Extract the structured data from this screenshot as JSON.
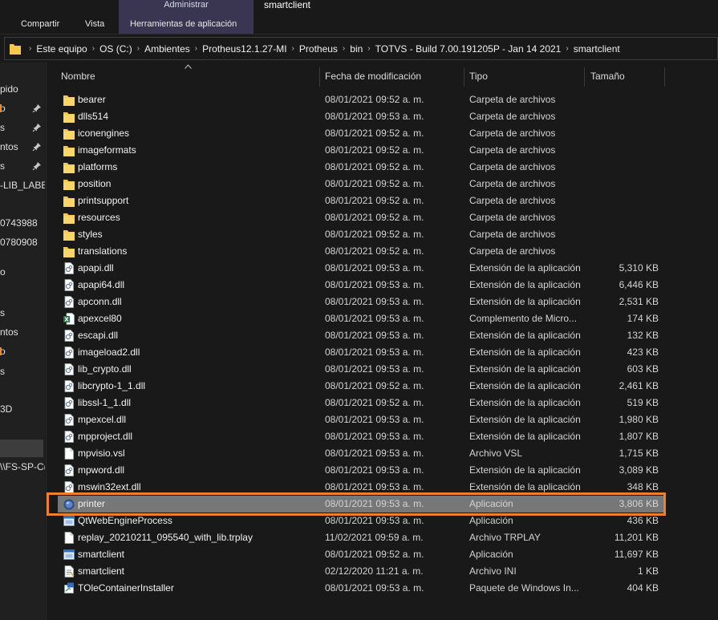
{
  "ribbon": {
    "context_title": "Administrar",
    "window_title": "smartclient",
    "tabs": [
      "Compartir",
      "Vista",
      "Herramientas de aplicación"
    ]
  },
  "address": {
    "crumbs": [
      "Este equipo",
      "OS (C:)",
      "Ambientes",
      "Protheus12.1.27-MI",
      "Protheus",
      "bin",
      "TOTVS - Build 7.00.191205P - Jan 14 2021",
      "smartclient"
    ]
  },
  "nav": {
    "items": [
      "pido",
      "o",
      "s",
      "ntos",
      "s",
      "-LIB_LABEL",
      "0743988",
      "0780908",
      "o",
      "s",
      "ntos",
      "o",
      "s",
      "3D",
      "\\\\FS-SP-C("
    ]
  },
  "columns": {
    "name": "Nombre",
    "date": "Fecha de modificación",
    "type": "Tipo",
    "size": "Tamaño"
  },
  "files": [
    {
      "name": "bearer",
      "date": "08/01/2021 09:52 a. m.",
      "type": "Carpeta de archivos",
      "size": "",
      "icon": "folder-icon"
    },
    {
      "name": "dlls514",
      "date": "08/01/2021 09:53 a. m.",
      "type": "Carpeta de archivos",
      "size": "",
      "icon": "folder-icon"
    },
    {
      "name": "iconengines",
      "date": "08/01/2021 09:52 a. m.",
      "type": "Carpeta de archivos",
      "size": "",
      "icon": "folder-icon"
    },
    {
      "name": "imageformats",
      "date": "08/01/2021 09:52 a. m.",
      "type": "Carpeta de archivos",
      "size": "",
      "icon": "folder-icon"
    },
    {
      "name": "platforms",
      "date": "08/01/2021 09:52 a. m.",
      "type": "Carpeta de archivos",
      "size": "",
      "icon": "folder-icon"
    },
    {
      "name": "position",
      "date": "08/01/2021 09:52 a. m.",
      "type": "Carpeta de archivos",
      "size": "",
      "icon": "folder-icon"
    },
    {
      "name": "printsupport",
      "date": "08/01/2021 09:52 a. m.",
      "type": "Carpeta de archivos",
      "size": "",
      "icon": "folder-icon"
    },
    {
      "name": "resources",
      "date": "08/01/2021 09:52 a. m.",
      "type": "Carpeta de archivos",
      "size": "",
      "icon": "folder-icon"
    },
    {
      "name": "styles",
      "date": "08/01/2021 09:52 a. m.",
      "type": "Carpeta de archivos",
      "size": "",
      "icon": "folder-icon"
    },
    {
      "name": "translations",
      "date": "08/01/2021 09:52 a. m.",
      "type": "Carpeta de archivos",
      "size": "",
      "icon": "folder-icon"
    },
    {
      "name": "apapi.dll",
      "date": "08/01/2021 09:53 a. m.",
      "type": "Extensión de la aplicación",
      "size": "5,310 KB",
      "icon": "dll-file-icon"
    },
    {
      "name": "apapi64.dll",
      "date": "08/01/2021 09:53 a. m.",
      "type": "Extensión de la aplicación",
      "size": "6,446 KB",
      "icon": "dll-file-icon"
    },
    {
      "name": "apconn.dll",
      "date": "08/01/2021 09:53 a. m.",
      "type": "Extensión de la aplicación",
      "size": "2,531 KB",
      "icon": "dll-file-icon"
    },
    {
      "name": "apexcel80",
      "date": "08/01/2021 09:53 a. m.",
      "type": "Complemento de Micro...",
      "size": "174 KB",
      "icon": "excel-addin-icon"
    },
    {
      "name": "escapi.dll",
      "date": "08/01/2021 09:53 a. m.",
      "type": "Extensión de la aplicación",
      "size": "132 KB",
      "icon": "dll-file-icon"
    },
    {
      "name": "imageload2.dll",
      "date": "08/01/2021 09:53 a. m.",
      "type": "Extensión de la aplicación",
      "size": "423 KB",
      "icon": "dll-file-icon"
    },
    {
      "name": "lib_crypto.dll",
      "date": "08/01/2021 09:53 a. m.",
      "type": "Extensión de la aplicación",
      "size": "603 KB",
      "icon": "dll-file-icon"
    },
    {
      "name": "libcrypto-1_1.dll",
      "date": "08/01/2021 09:52 a. m.",
      "type": "Extensión de la aplicación",
      "size": "2,461 KB",
      "icon": "dll-file-icon"
    },
    {
      "name": "libssl-1_1.dll",
      "date": "08/01/2021 09:52 a. m.",
      "type": "Extensión de la aplicación",
      "size": "519 KB",
      "icon": "dll-file-icon"
    },
    {
      "name": "mpexcel.dll",
      "date": "08/01/2021 09:53 a. m.",
      "type": "Extensión de la aplicación",
      "size": "1,980 KB",
      "icon": "dll-file-icon"
    },
    {
      "name": "mpproject.dll",
      "date": "08/01/2021 09:53 a. m.",
      "type": "Extensión de la aplicación",
      "size": "1,807 KB",
      "icon": "dll-file-icon"
    },
    {
      "name": "mpvisio.vsl",
      "date": "08/01/2021 09:53 a. m.",
      "type": "Archivo VSL",
      "size": "1,715 KB",
      "icon": "blank-file-icon"
    },
    {
      "name": "mpword.dll",
      "date": "08/01/2021 09:53 a. m.",
      "type": "Extensión de la aplicación",
      "size": "3,089 KB",
      "icon": "dll-file-icon"
    },
    {
      "name": "mswin32ext.dll",
      "date": "08/01/2021 09:53 a. m.",
      "type": "Extensión de la aplicación",
      "size": "348 KB",
      "icon": "dll-file-icon"
    },
    {
      "name": "printer",
      "date": "08/01/2021 09:53 a. m.",
      "type": "Aplicación",
      "size": "3,806 KB",
      "icon": "printer-app-icon",
      "selected": true
    },
    {
      "name": "QtWebEngineProcess",
      "date": "08/01/2021 09:53 a. m.",
      "type": "Aplicación",
      "size": "436 KB",
      "icon": "app-window-icon"
    },
    {
      "name": "replay_20210211_095540_with_lib.trplay",
      "date": "11/02/2021 09:59 a. m.",
      "type": "Archivo TRPLAY",
      "size": "11,201 KB",
      "icon": "blank-file-icon"
    },
    {
      "name": "smartclient",
      "date": "08/01/2021 09:52 a. m.",
      "type": "Aplicación",
      "size": "11,697 KB",
      "icon": "app-window-icon"
    },
    {
      "name": "smartclient",
      "date": "02/12/2020 11:21 a. m.",
      "type": "Archivo INI",
      "size": "1 KB",
      "icon": "ini-file-icon"
    },
    {
      "name": "TOleContainerInstaller",
      "date": "08/01/2021 09:53 a. m.",
      "type": "Paquete de Windows In...",
      "size": "404 KB",
      "icon": "msi-package-icon"
    }
  ],
  "colors": {
    "highlight": "#f07f2c",
    "selected_row": "#777777",
    "folder": "#f5c84b",
    "context_band": "#3a3652"
  }
}
